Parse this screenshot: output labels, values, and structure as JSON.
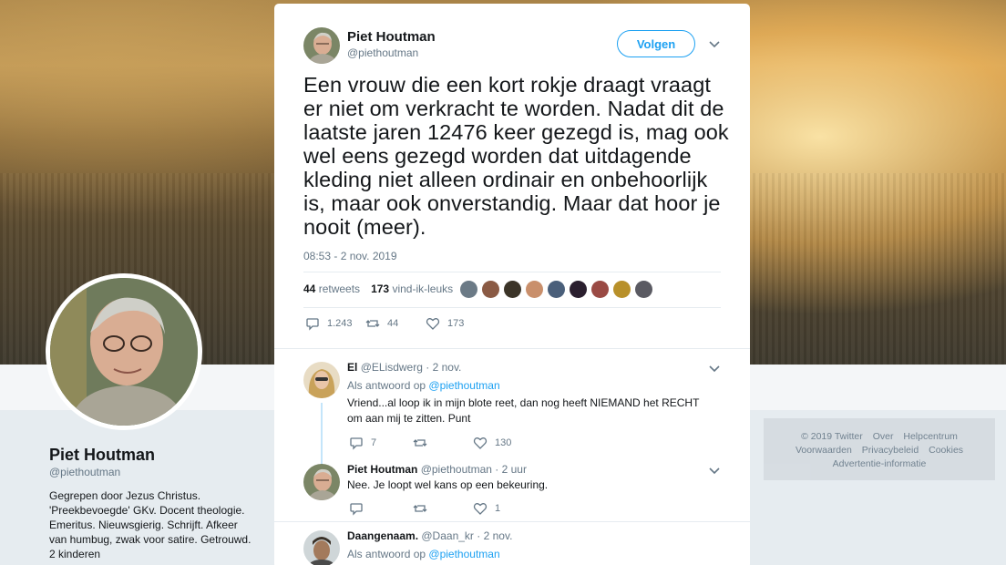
{
  "profile": {
    "name": "Piet Houtman",
    "handle": "@piethoutman",
    "bio": "Gegrepen door Jezus Christus. 'Preekbevoegde' GKv. Docent theologie. Emeritus. Nieuwsgierig. Schrijft. Afkeer van humbug, zwak voor satire. Getrouwd. 2 kinderen"
  },
  "footer": {
    "links": [
      "© 2019 Twitter",
      "Over",
      "Helpcentrum",
      "Voorwaarden",
      "Privacybeleid",
      "Cookies",
      "Advertentie-informatie"
    ]
  },
  "tweet": {
    "author_name": "Piet Houtman",
    "author_handle": "@piethoutman",
    "follow_label": "Volgen",
    "text": "Een vrouw die een kort rokje draagt vraagt er niet om verkracht te worden. Nadat dit de laatste jaren 12476 keer gezegd is, mag ook wel eens gezegd worden dat uitdagende kleding niet alleen ordinair en onbehoorlijk is, maar ook onverstandig. Maar dat hoor je nooit (meer).",
    "timestamp": "08:53 - 2 nov. 2019",
    "retweets_count": "44",
    "retweets_label": "retweets",
    "likes_count": "173",
    "likes_label": "vind-ik-leuks",
    "replies_action": "1.243",
    "retweets_action": "44",
    "likes_action": "173"
  },
  "replies": [
    {
      "name": "El",
      "handle": "@ELisdwerg",
      "time": "2 nov.",
      "reply_prefix": "Als antwoord op",
      "reply_to": "@piethoutman",
      "text": "Vriend...al loop ik in mijn blote reet, dan nog heeft NIEMAND het RECHT om aan mij te zitten. Punt",
      "replies": "7",
      "retweets": "",
      "likes": "130"
    },
    {
      "name": "Piet Houtman",
      "handle": "@piethoutman",
      "time": "2 uur",
      "text": "Nee. Je loopt wel kans op een bekeuring.",
      "replies": "",
      "retweets": "",
      "likes": "1"
    },
    {
      "name": "Daangenaam.",
      "handle": "@Daan_kr",
      "time": "2 nov.",
      "reply_prefix": "Als antwoord op",
      "reply_to": "@piethoutman"
    }
  ],
  "colors": {
    "accent": "#1da1f2",
    "muted": "#657786",
    "text": "#14171a"
  }
}
